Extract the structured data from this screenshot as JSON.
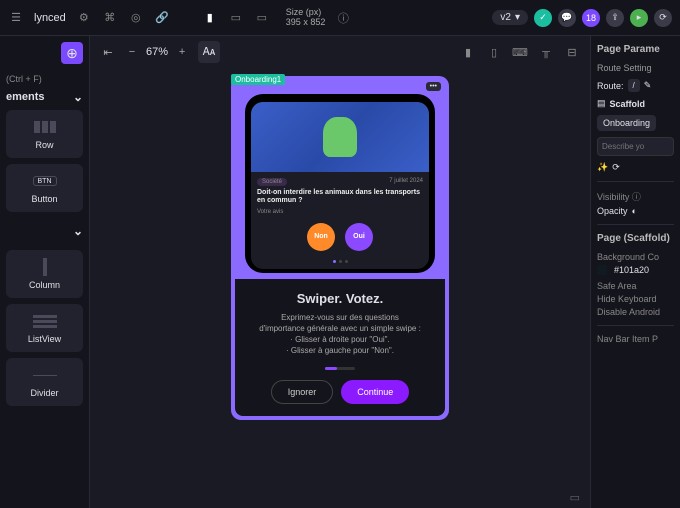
{
  "topbar": {
    "project_name": "lynced",
    "size_label": "Size (px)",
    "size_value": "395 x 852",
    "version": "v2",
    "badge_count": "18"
  },
  "left": {
    "shortcut": "(Ctrl + F)",
    "section": "ements",
    "items": [
      "Row",
      "Button",
      "Column",
      "ListView",
      "Divider"
    ]
  },
  "toolbar": {
    "zoom": "67%"
  },
  "device": {
    "tag": "Onboarding1",
    "badge": "•••",
    "card_chip": "Société",
    "card_meta_right": "7 juillet 2024",
    "card_title": "Doit-on interdire les animaux dans les transports en commun ?",
    "card_sub": "Votre avis",
    "action_no": "Non",
    "action_yes": "Oui",
    "onb_title": "Swiper. Votez.",
    "onb_line1": "Exprimez-vous sur des questions",
    "onb_line2": "d'importance générale avec un simple swipe :",
    "onb_line3": "· Glisser à droite pour \"Oui\".",
    "onb_line4": "· Glisser à gauche pour \"Non\".",
    "btn_ignore": "Ignorer",
    "btn_continue": "Continue"
  },
  "right": {
    "section1": "Page Parame",
    "section2": "Route Setting",
    "route_label": "Route:",
    "route_value": "/",
    "scaffold": "Scaffold",
    "scaffold_name": "Onboarding",
    "describe_placeholder": "Describe yo",
    "visibility": "Visibility",
    "opacity": "Opacity",
    "page_section": "Page (Scaffold)",
    "bg_label": "Background Co",
    "bg_value": "#101a20",
    "safe_area": "Safe Area",
    "hide_kb": "Hide Keyboard",
    "disable_android": "Disable Android",
    "nav_bar": "Nav Bar Item P"
  }
}
